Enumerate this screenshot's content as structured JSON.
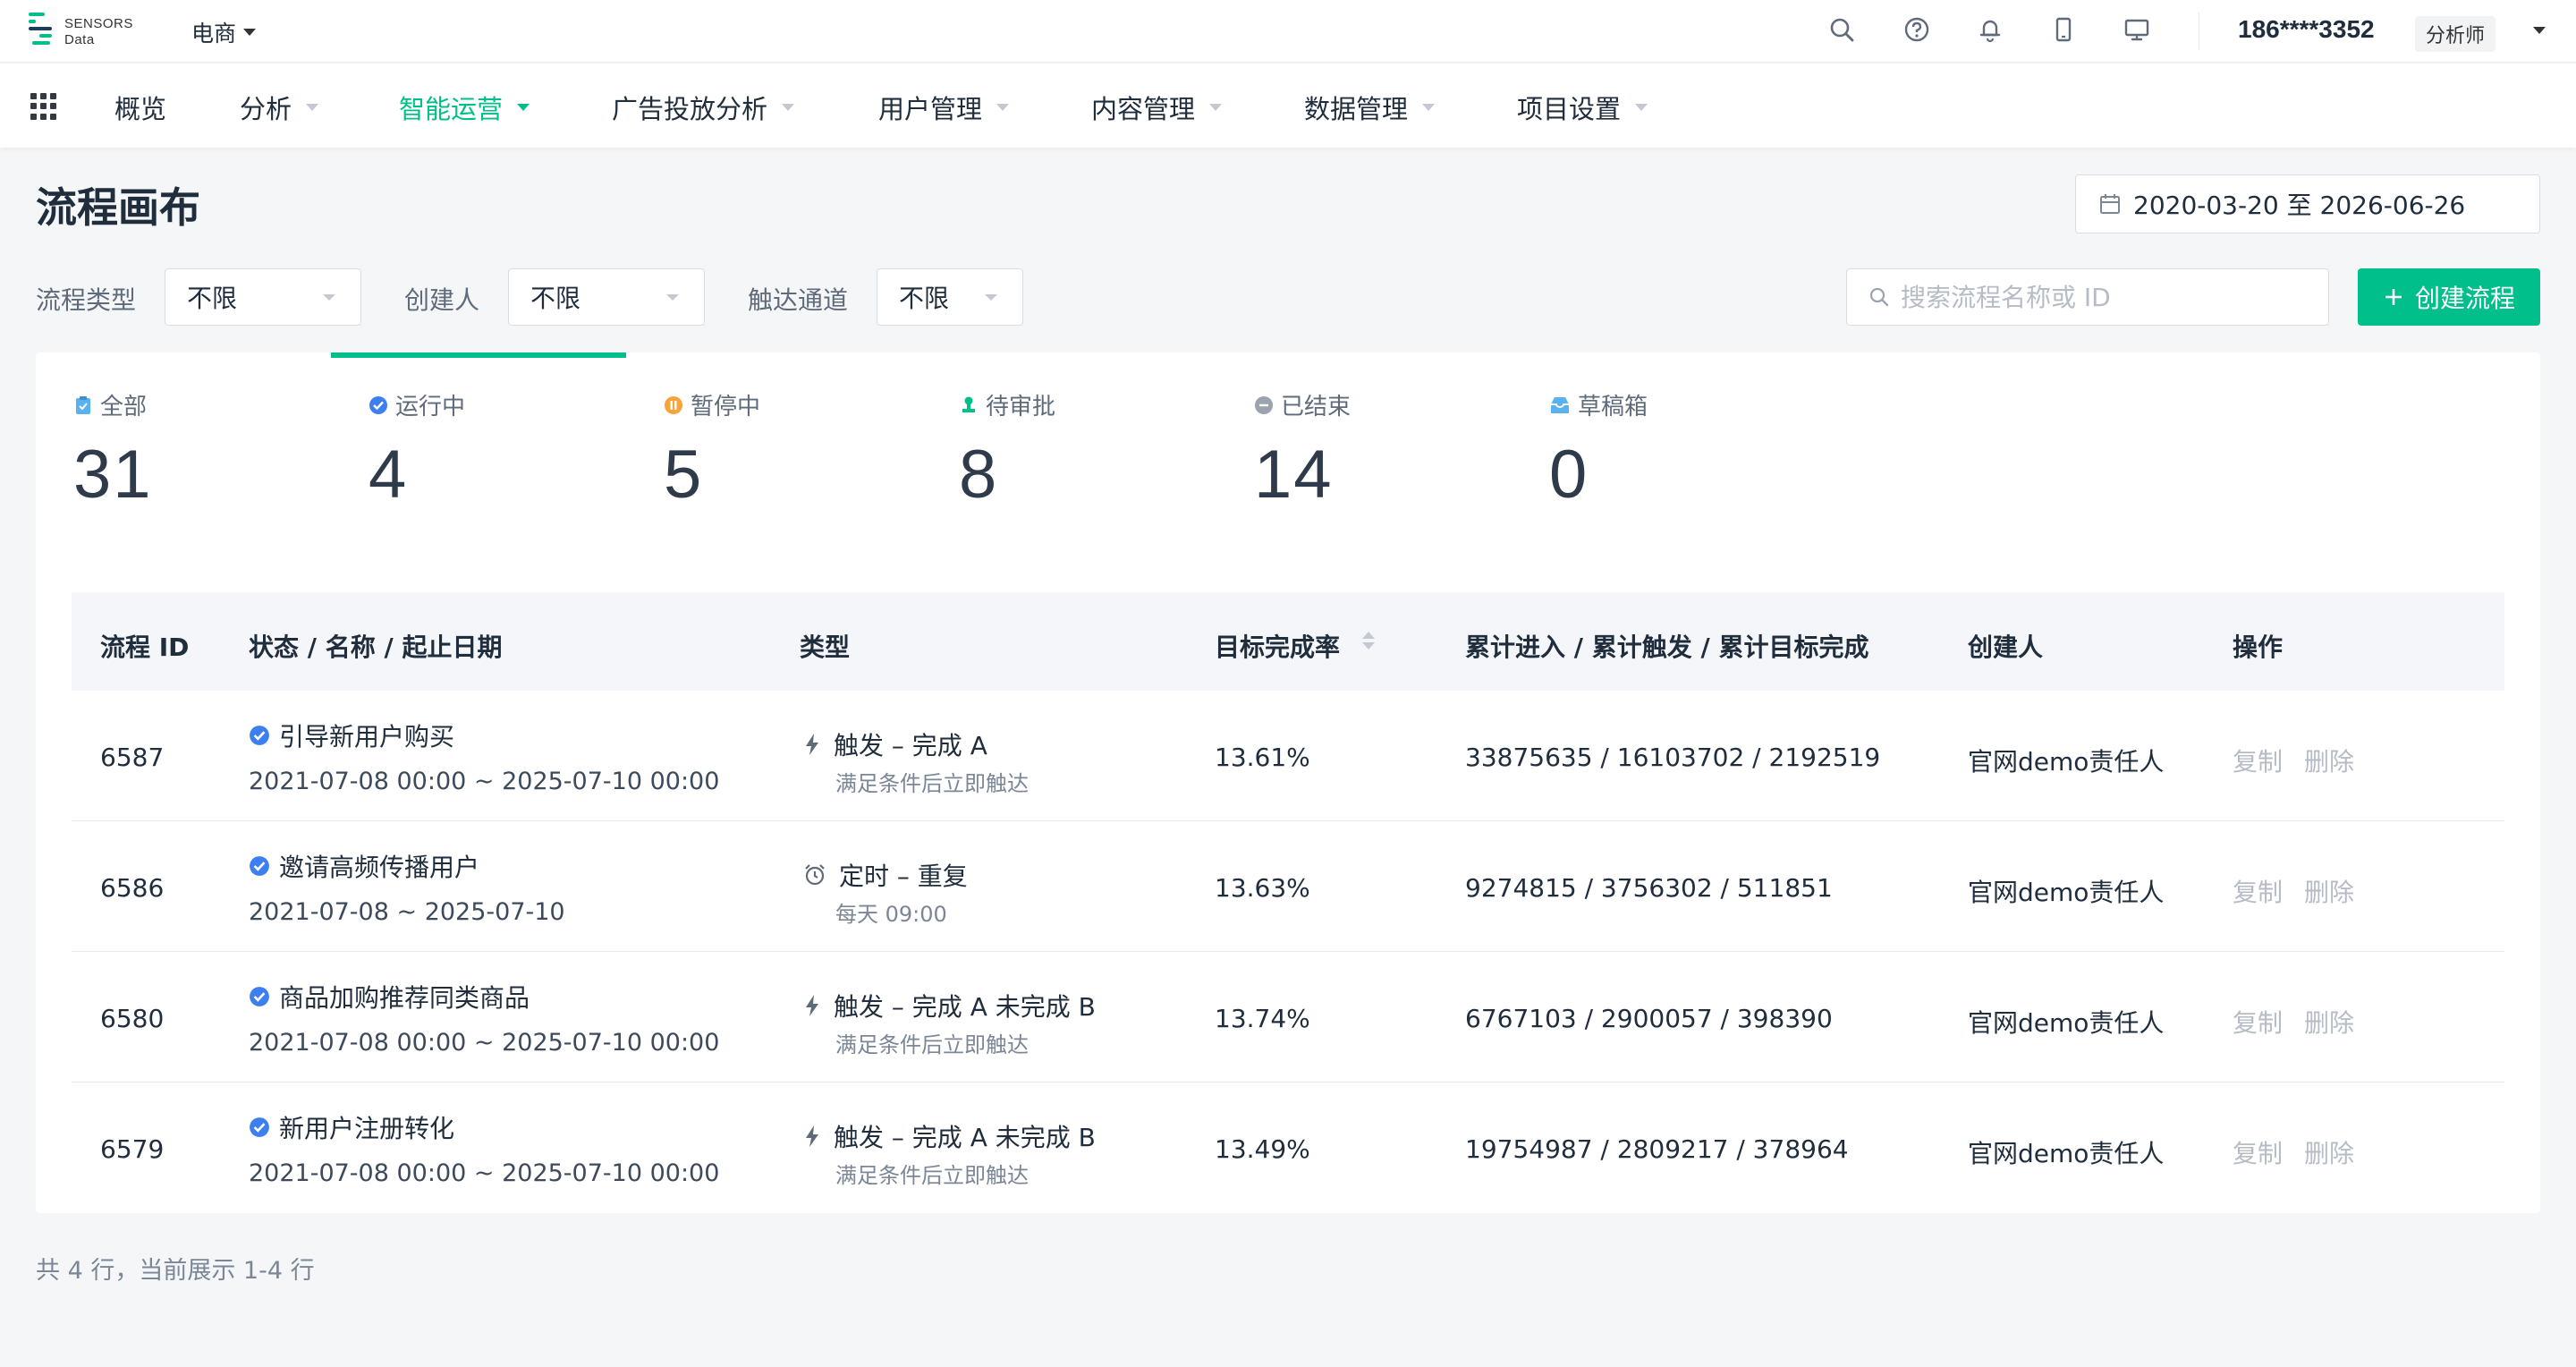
{
  "header": {
    "logo_text_line1": "SENSORS",
    "logo_text_line2": "Data",
    "project": "电商",
    "user": "186****3352",
    "role": "分析师"
  },
  "nav": {
    "items": [
      {
        "label": "概览"
      },
      {
        "label": "分析"
      },
      {
        "label": "智能运营"
      },
      {
        "label": "广告投放分析"
      },
      {
        "label": "用户管理"
      },
      {
        "label": "内容管理"
      },
      {
        "label": "数据管理"
      },
      {
        "label": "项目设置"
      }
    ]
  },
  "page": {
    "title": "流程画布",
    "date_range": "2020-03-20 至 2026-06-26"
  },
  "filters": {
    "type_label": "流程类型",
    "type_value": "不限",
    "creator_label": "创建人",
    "creator_value": "不限",
    "channel_label": "触达通道",
    "channel_value": "不限",
    "search_placeholder": "搜索流程名称或 ID",
    "create_label": "创建流程"
  },
  "stats": [
    {
      "label": "全部",
      "value": "31",
      "icon": "clipboard-icon",
      "color": "#5ab1ef"
    },
    {
      "label": "运行中",
      "value": "4",
      "icon": "check-circle-icon",
      "color": "#3d7ff0"
    },
    {
      "label": "暂停中",
      "value": "5",
      "icon": "pause-circle-icon",
      "color": "#f7a53a"
    },
    {
      "label": "待审批",
      "value": "8",
      "icon": "approve-icon",
      "color": "#00bf8a"
    },
    {
      "label": "已结束",
      "value": "14",
      "icon": "minus-circle-icon",
      "color": "#9aa3ae"
    },
    {
      "label": "草稿箱",
      "value": "0",
      "icon": "draft-box-icon",
      "color": "#5ab1ef"
    }
  ],
  "table": {
    "headers": {
      "id": "流程 ID",
      "status": "状态 / 名称 / 起止日期",
      "type": "类型",
      "rate": "目标完成率",
      "counts": "累计进入 / 累计触发 / 累计目标完成",
      "creator": "创建人",
      "ops": "操作"
    },
    "rows": [
      {
        "id": "6587",
        "name": "引导新用户购买",
        "dates": "2021-07-08 00:00 ~ 2025-07-10 00:00",
        "type": "触发 – 完成 A",
        "type_icon": "lightning-icon",
        "type_sub": "满足条件后立即触达",
        "rate": "13.61%",
        "counts": "33875635 / 16103702 / 2192519",
        "creator": "官网demo责任人",
        "copy": "复制",
        "delete": "删除"
      },
      {
        "id": "6586",
        "name": "邀请高频传播用户",
        "dates": "2021-07-08 ~ 2025-07-10",
        "type": "定时 – 重复",
        "type_icon": "alarm-clock-icon",
        "type_sub": "每天 09:00",
        "rate": "13.63%",
        "counts": "9274815 / 3756302 / 511851",
        "creator": "官网demo责任人",
        "copy": "复制",
        "delete": "删除"
      },
      {
        "id": "6580",
        "name": "商品加购推荐同类商品",
        "dates": "2021-07-08 00:00 ~ 2025-07-10 00:00",
        "type": "触发 – 完成 A 未完成 B",
        "type_icon": "lightning-icon",
        "type_sub": "满足条件后立即触达",
        "rate": "13.74%",
        "counts": "6767103 / 2900057 / 398390",
        "creator": "官网demo责任人",
        "copy": "复制",
        "delete": "删除"
      },
      {
        "id": "6579",
        "name": "新用户注册转化",
        "dates": "2021-07-08 00:00 ~ 2025-07-10 00:00",
        "type": "触发 – 完成 A 未完成 B",
        "type_icon": "lightning-icon",
        "type_sub": "满足条件后立即触达",
        "rate": "13.49%",
        "counts": "19754987 / 2809217 / 378964",
        "creator": "官网demo责任人",
        "copy": "复制",
        "delete": "删除"
      }
    ]
  },
  "footer": {
    "summary": "共 4 行，当前展示 1-4 行"
  },
  "colors": {
    "accent": "#00bf8a",
    "running": "#3d7ff0"
  }
}
